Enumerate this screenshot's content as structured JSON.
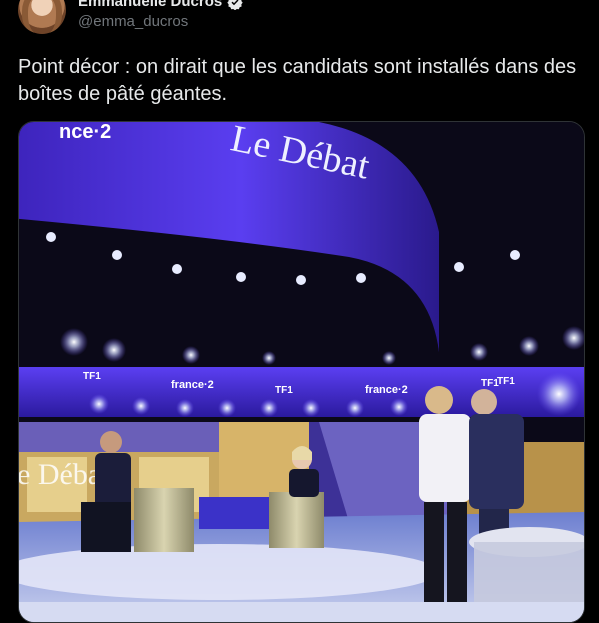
{
  "author": {
    "display_name": "Emmanuelle Ducros",
    "handle": "@emma_ducros",
    "verified": true
  },
  "tweet": {
    "text": "Point décor : on dirait que les candidats sont installés dans des boîtes de pâté géantes."
  },
  "media": {
    "arch_text": "Le Débat",
    "channel_logo_top": "nce·2",
    "logos": {
      "france2_a": "france·2",
      "tf1_a": "TF1",
      "france2_b": "france·2",
      "tf1_b": "TF1",
      "tf1_c": "TF1",
      "tf1_d": "TF1"
    },
    "screen_text": "e Déba"
  },
  "colors": {
    "background": "#000000",
    "text": "#e7e9ea",
    "secondary": "#71767b",
    "verified": "#e7e9ea",
    "studio_purple": "#4b2fd6"
  },
  "icons": [
    "verified-badge-icon",
    "more-options-icon"
  ]
}
